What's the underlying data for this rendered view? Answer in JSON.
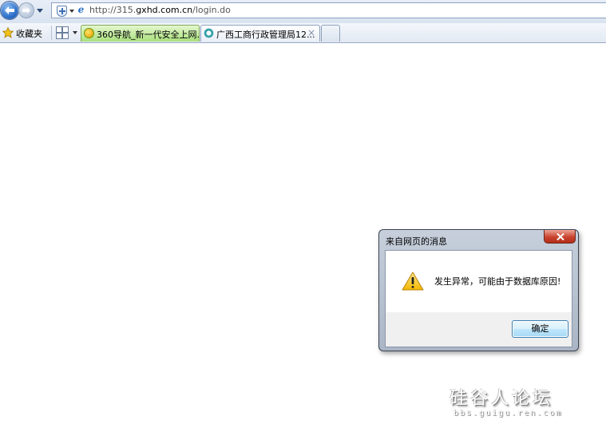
{
  "address_bar": {
    "url_prefix": "http://315.",
    "url_domain": "gxhd.com.cn",
    "url_path": "/login.do"
  },
  "favorites": {
    "label": "收藏夹"
  },
  "tabs": [
    {
      "title": "360导航_新一代安全上网...",
      "active": false,
      "color": "#a9e07c"
    },
    {
      "title": "广西工商行政管理局12...",
      "active": true,
      "close": "×"
    }
  ],
  "dialog": {
    "title": "来自网页的消息",
    "message": "发生异常，可能由于数据库原因!",
    "ok_label": "确定",
    "icon": "warning-icon"
  },
  "watermark": {
    "text": "硅谷人论坛",
    "sub": "bbs.guigu.ren.com"
  }
}
